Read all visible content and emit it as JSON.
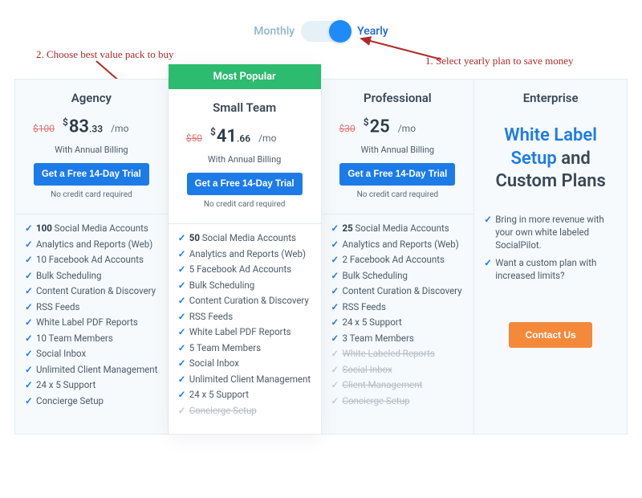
{
  "toggle": {
    "monthly": "Monthly",
    "yearly": "Yearly",
    "selected": "yearly"
  },
  "annotations": {
    "right": "1. Select yearly plan to save money",
    "left": "2. Choose best value pack to buy"
  },
  "common": {
    "billing_note": "With Annual Billing",
    "cta": "Get a Free 14-Day Trial",
    "no_card": "No credit card required",
    "popular_badge": "Most Popular"
  },
  "plans": [
    {
      "title": "Agency",
      "original": "$100",
      "dollars": "83",
      "cents": ".33",
      "per": "/mo",
      "features": [
        {
          "bold": "100",
          "text": " Social Media Accounts"
        },
        {
          "text": "Analytics and Reports (Web)"
        },
        {
          "text": "10 Facebook Ad Accounts"
        },
        {
          "text": "Bulk Scheduling"
        },
        {
          "text": "Content Curation & Discovery"
        },
        {
          "text": "RSS Feeds"
        },
        {
          "text": "White Label PDF Reports"
        },
        {
          "text": "10 Team Members"
        },
        {
          "text": "Social Inbox"
        },
        {
          "text": "Unlimited Client Management"
        },
        {
          "text": "24 x 5 Support"
        },
        {
          "text": "Concierge Setup"
        }
      ]
    },
    {
      "title": "Small Team",
      "original": "$50",
      "dollars": "41",
      "cents": ".66",
      "per": "/mo",
      "popular": true,
      "features": [
        {
          "bold": "50",
          "text": " Social Media Accounts"
        },
        {
          "text": "Analytics and Reports (Web)"
        },
        {
          "text": "5 Facebook Ad Accounts"
        },
        {
          "text": "Bulk Scheduling"
        },
        {
          "text": "Content Curation & Discovery"
        },
        {
          "text": "RSS Feeds"
        },
        {
          "text": "White Label PDF Reports"
        },
        {
          "text": "5 Team Members"
        },
        {
          "text": "Social Inbox"
        },
        {
          "text": "Unlimited Client Management"
        },
        {
          "text": "24 x 5 Support"
        },
        {
          "text": "Concierge Setup",
          "muted": true
        }
      ]
    },
    {
      "title": "Professional",
      "original": "$30",
      "dollars": "25",
      "cents": "",
      "per": "/mo",
      "features": [
        {
          "bold": "25",
          "text": " Social Media Accounts"
        },
        {
          "text": "Analytics and Reports (Web)"
        },
        {
          "text": "2 Facebook Ad Accounts"
        },
        {
          "text": "Bulk Scheduling"
        },
        {
          "text": "Content Curation & Discovery"
        },
        {
          "text": "RSS Feeds"
        },
        {
          "text": "24 x 5 Support"
        },
        {
          "text": "3 Team Members"
        },
        {
          "text": "White Labeled Reports",
          "muted": true
        },
        {
          "text": "Social Inbox",
          "muted": true
        },
        {
          "text": "Client Management",
          "muted": true
        },
        {
          "text": "Concierge Setup",
          "muted": true
        }
      ]
    }
  ],
  "enterprise": {
    "title": "Enterprise",
    "headline_blue": "White Label Setup",
    "headline_rest": " and Custom Plans",
    "features": [
      "Bring in more revenue with your own white labeled SocialPilot.",
      "Want a custom plan with increased limits?"
    ],
    "cta": "Contact Us"
  }
}
